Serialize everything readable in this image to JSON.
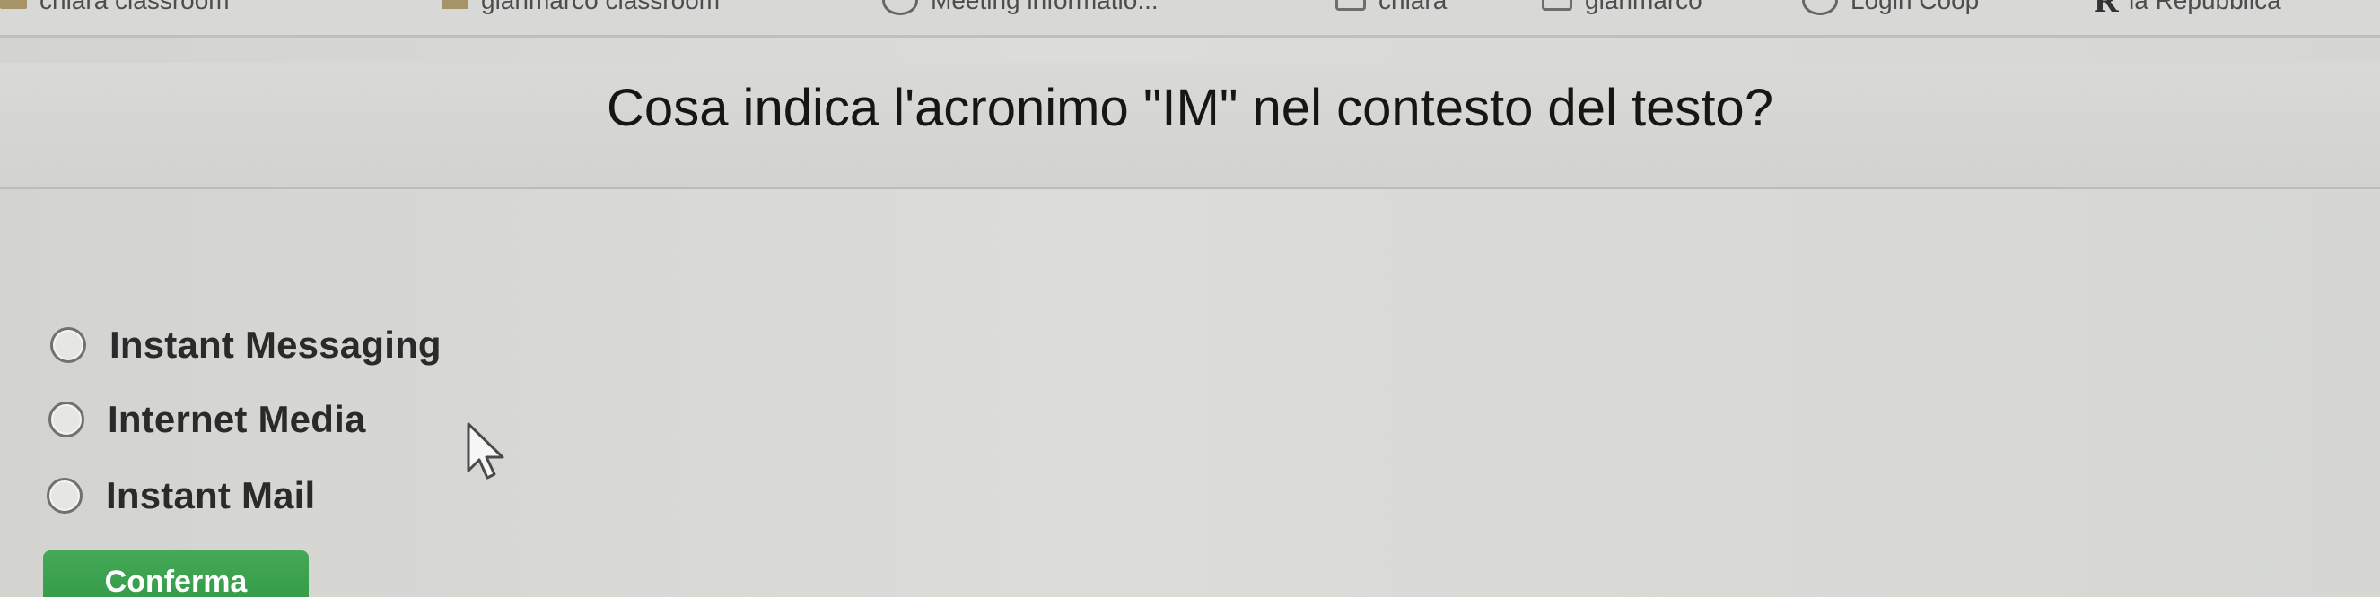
{
  "bookmarks": {
    "items": [
      {
        "label": "chiara classroom",
        "icon": "folder-icon"
      },
      {
        "label": "gianmarco classroom",
        "icon": "folder-icon"
      },
      {
        "label": "Meeting informatio...",
        "icon": "globe-icon"
      },
      {
        "label": "chiara",
        "icon": "folder-icon"
      },
      {
        "label": "gianmarco",
        "icon": "folder-icon"
      },
      {
        "label": "Login Coop",
        "icon": "globe-icon"
      },
      {
        "label": "la Repubblica",
        "icon": "newspaper-icon"
      }
    ]
  },
  "quiz": {
    "question": "Cosa indica l'acronimo \"IM\" nel contesto del testo?",
    "options": [
      {
        "label": "Instant Messaging",
        "selected": false
      },
      {
        "label": "Internet Media",
        "selected": false
      },
      {
        "label": "Instant Mail",
        "selected": false
      }
    ],
    "confirm_label": "Conferma"
  },
  "colors": {
    "background": "#d9d9d6",
    "button": "#36a04c",
    "text": "#161616"
  }
}
